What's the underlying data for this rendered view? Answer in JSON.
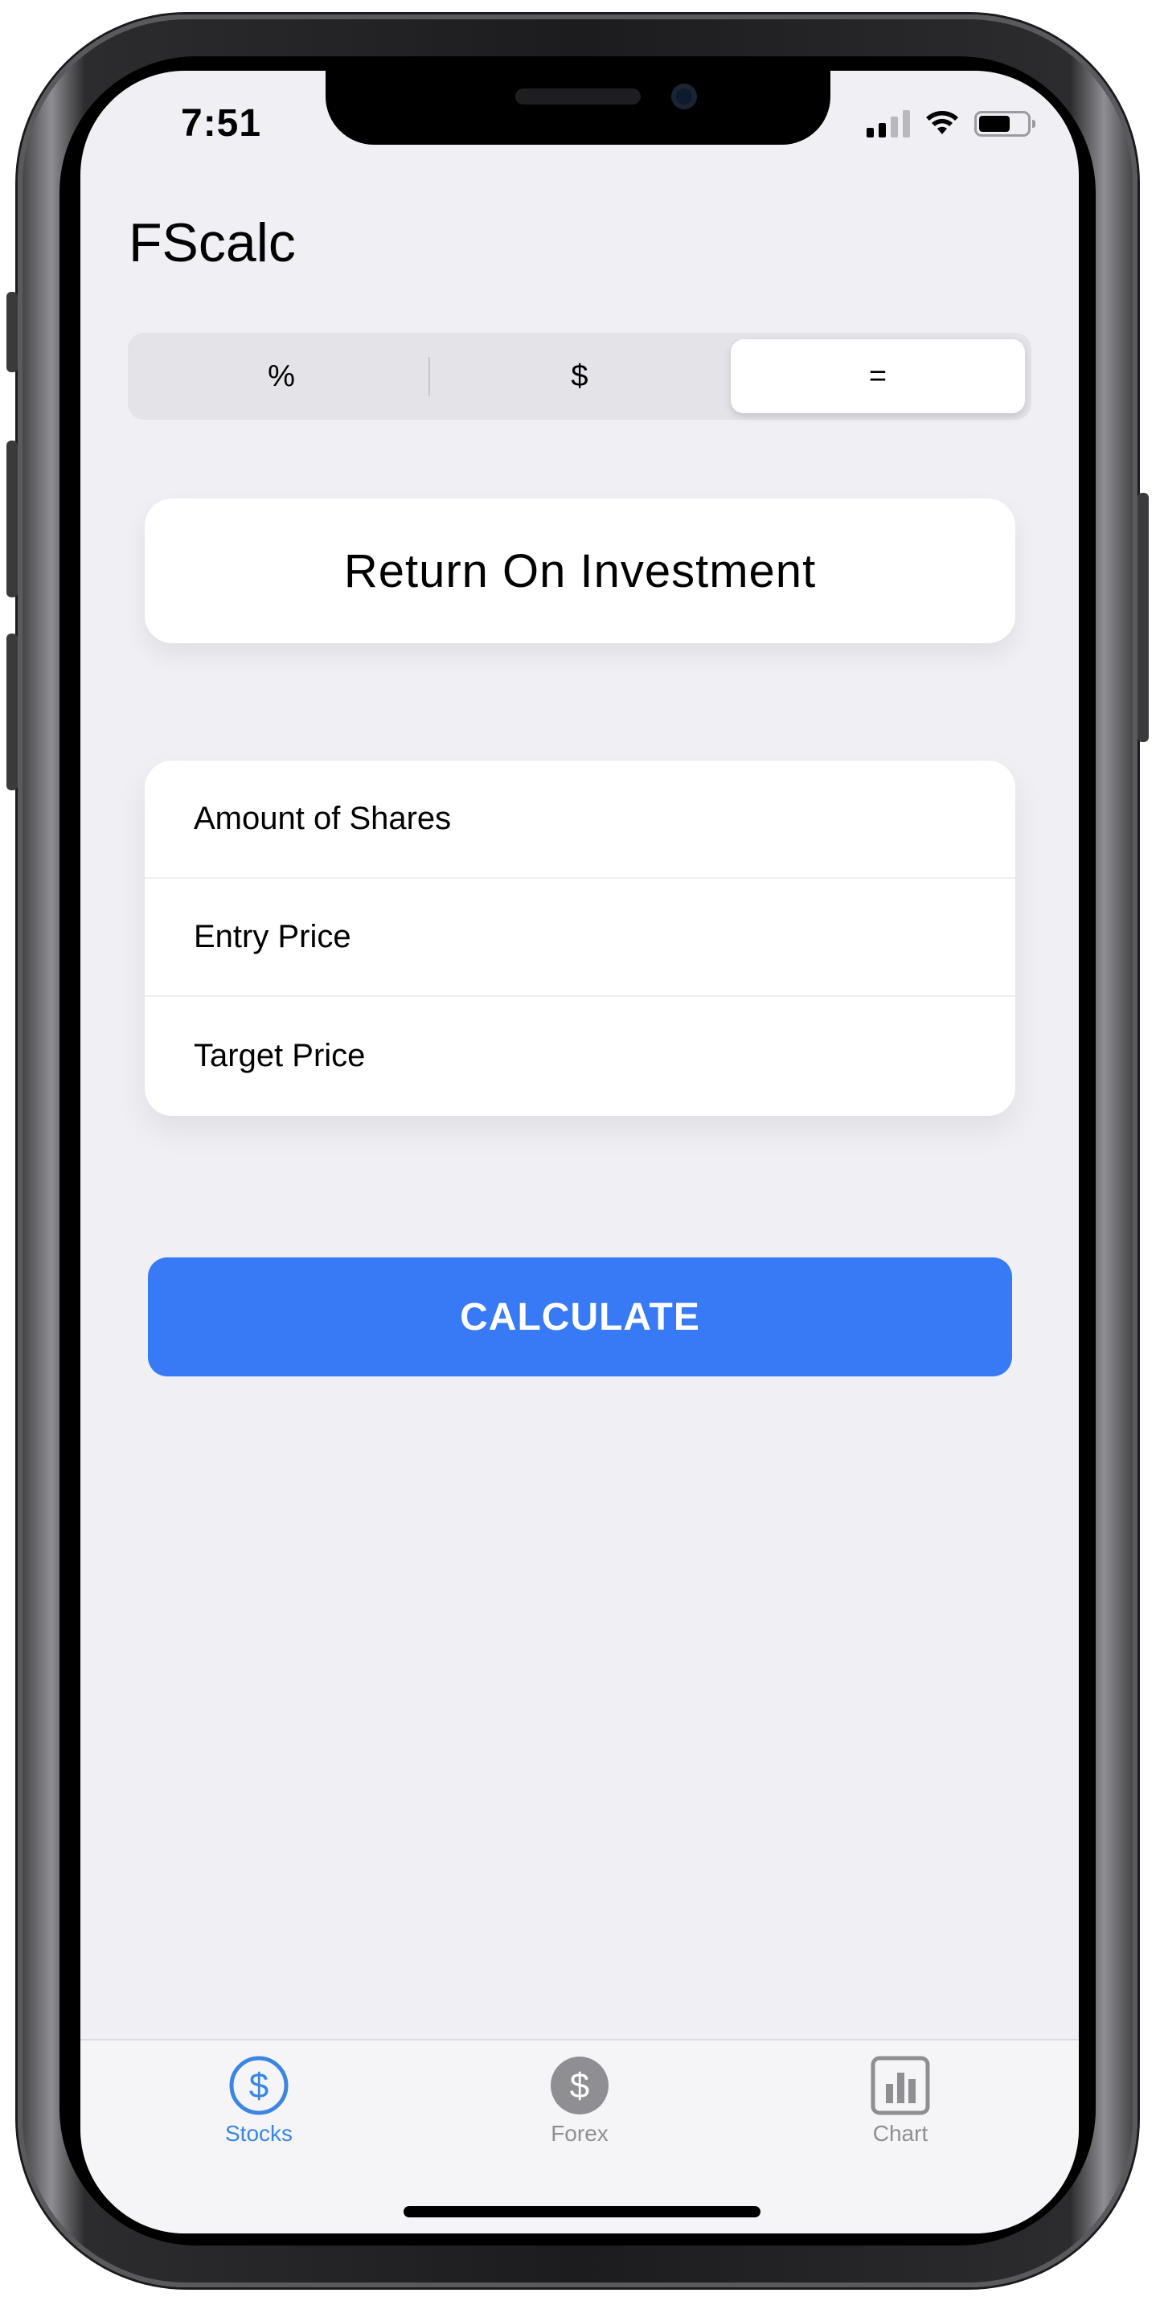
{
  "status_bar": {
    "time": "7:51"
  },
  "app": {
    "title": "FScalc"
  },
  "segmented_control": {
    "segments": [
      "%",
      "$",
      "="
    ],
    "selected_index": 2
  },
  "mode": {
    "title": "Return On Investment"
  },
  "form": {
    "fields": [
      {
        "placeholder": "Amount of Shares",
        "value": ""
      },
      {
        "placeholder": "Entry Price",
        "value": ""
      },
      {
        "placeholder": "Target Price",
        "value": ""
      }
    ]
  },
  "actions": {
    "calculate_label": "CALCULATE"
  },
  "tabbar": {
    "items": [
      {
        "label": "Stocks",
        "icon": "dollar-circle-outline-icon",
        "active": true
      },
      {
        "label": "Forex",
        "icon": "dollar-circle-filled-icon",
        "active": false
      },
      {
        "label": "Chart",
        "icon": "bar-chart-square-icon",
        "active": false
      }
    ]
  },
  "colors": {
    "accent": "#387af5",
    "tab_active": "#3a86e0",
    "tab_inactive": "#8e8e93",
    "background": "#efeff4"
  }
}
